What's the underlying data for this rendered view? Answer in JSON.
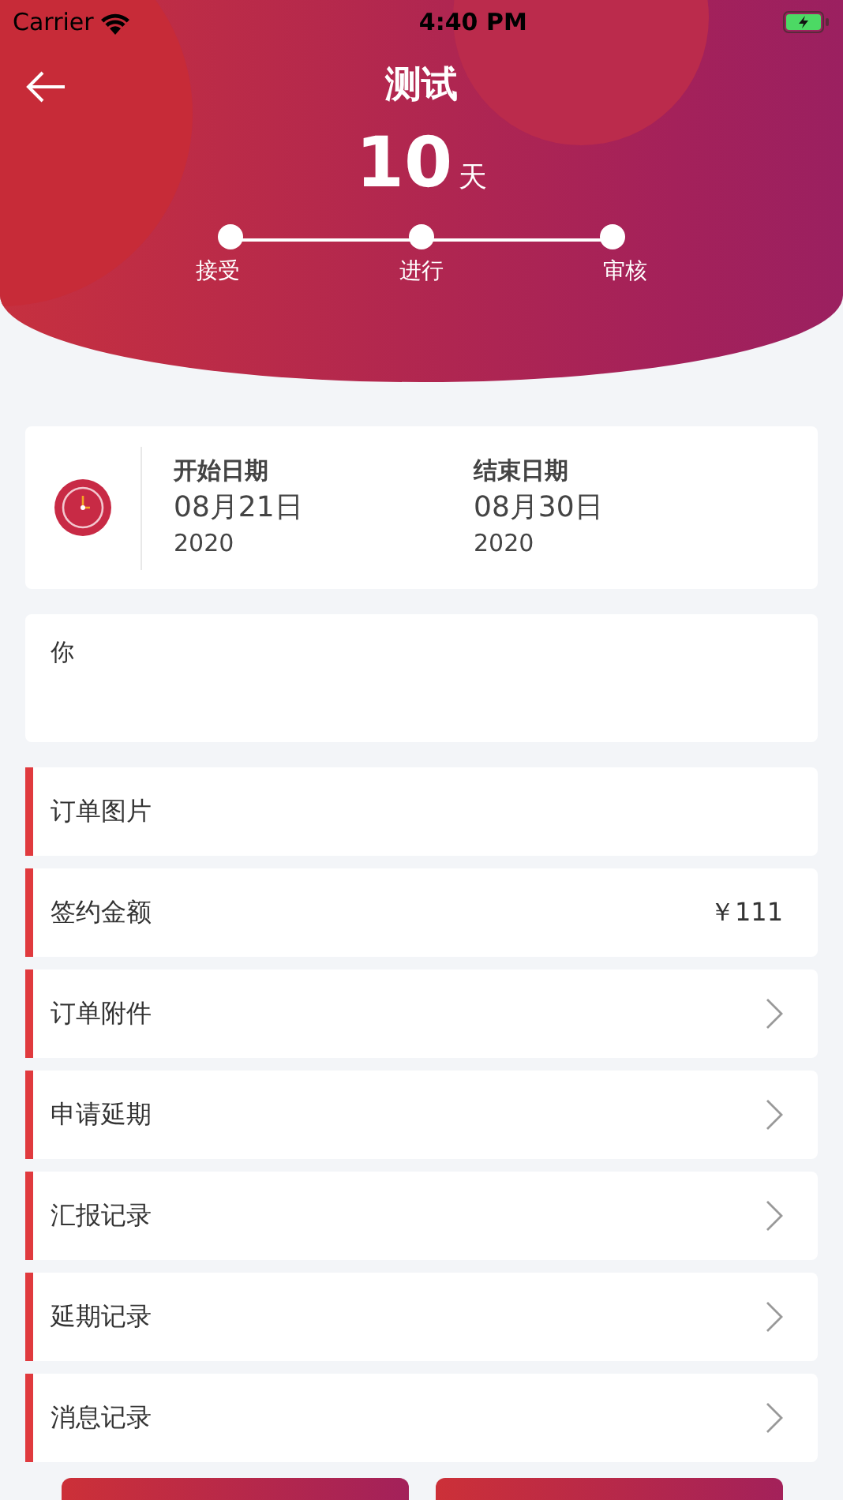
{
  "status_bar": {
    "carrier": "Carrier",
    "time": "4:40 PM"
  },
  "header": {
    "title": "测试",
    "days": "10",
    "days_unit": "天",
    "steps": [
      {
        "label": "接受"
      },
      {
        "label": "进行"
      },
      {
        "label": "审核"
      }
    ]
  },
  "dates": [
    {
      "label": "开始日期",
      "date": "08月21日",
      "year": "2020"
    },
    {
      "label": "结束日期",
      "date": "08月30日",
      "year": "2020"
    }
  ],
  "note": "你",
  "rows": [
    {
      "kind": "plain",
      "label": "订单图片"
    },
    {
      "kind": "value",
      "label": "签约金额",
      "value": "￥111"
    },
    {
      "kind": "link",
      "label": "订单附件"
    },
    {
      "kind": "link",
      "label": "申请延期"
    },
    {
      "kind": "link",
      "label": "汇报记录"
    },
    {
      "kind": "link",
      "label": "延期记录"
    },
    {
      "kind": "link",
      "label": "消息记录"
    }
  ],
  "bottom_buttons": [
    {
      "kind": "action"
    },
    {
      "kind": "action"
    }
  ]
}
